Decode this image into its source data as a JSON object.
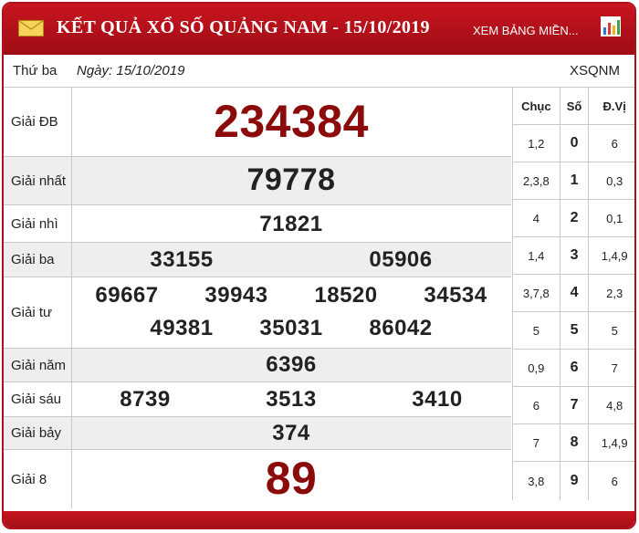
{
  "header": {
    "title": "KẾT QUẢ XỔ SỐ QUẢNG NAM - 15/10/2019",
    "link_label": "XEM BẢNG MIỀN...",
    "mail_icon": "mail-icon",
    "chart_icon": "bar-chart-icon",
    "accent_color": "#b0111b"
  },
  "subbar": {
    "weekday": "Thứ ba",
    "date_label": "Ngày: 15/10/2019",
    "code": "XSQNM"
  },
  "prizes": [
    {
      "label": "Giải ĐB",
      "numbers": [
        "234384"
      ]
    },
    {
      "label": "Giải nhất",
      "numbers": [
        "79778"
      ]
    },
    {
      "label": "Giải nhì",
      "numbers": [
        "71821"
      ]
    },
    {
      "label": "Giải ba",
      "numbers": [
        "33155",
        "05906"
      ]
    },
    {
      "label": "Giải tư",
      "numbers": [
        "69667",
        "39943",
        "18520",
        "34534",
        "49381",
        "35031",
        "86042"
      ]
    },
    {
      "label": "Giải năm",
      "numbers": [
        "6396"
      ]
    },
    {
      "label": "Giải sáu",
      "numbers": [
        "8739",
        "3513",
        "3410"
      ]
    },
    {
      "label": "Giải bảy",
      "numbers": [
        "374"
      ]
    },
    {
      "label": "Giải 8",
      "numbers": [
        "89"
      ]
    }
  ],
  "loto": {
    "headers": [
      "Chục",
      "Số",
      "Đ.Vị"
    ],
    "rows": [
      {
        "chuc": "1,2",
        "so": "0",
        "dv": "6"
      },
      {
        "chuc": "2,3,8",
        "so": "1",
        "dv": "0,3"
      },
      {
        "chuc": "4",
        "so": "2",
        "dv": "0,1"
      },
      {
        "chuc": "1,4",
        "so": "3",
        "dv": "1,4,9"
      },
      {
        "chuc": "3,7,8",
        "so": "4",
        "dv": "2,3"
      },
      {
        "chuc": "5",
        "so": "5",
        "dv": "5"
      },
      {
        "chuc": "0,9",
        "so": "6",
        "dv": "7"
      },
      {
        "chuc": "6",
        "so": "7",
        "dv": "4,8"
      },
      {
        "chuc": "7",
        "so": "8",
        "dv": "1,4,9"
      },
      {
        "chuc": "3,8",
        "so": "9",
        "dv": "6"
      }
    ]
  }
}
